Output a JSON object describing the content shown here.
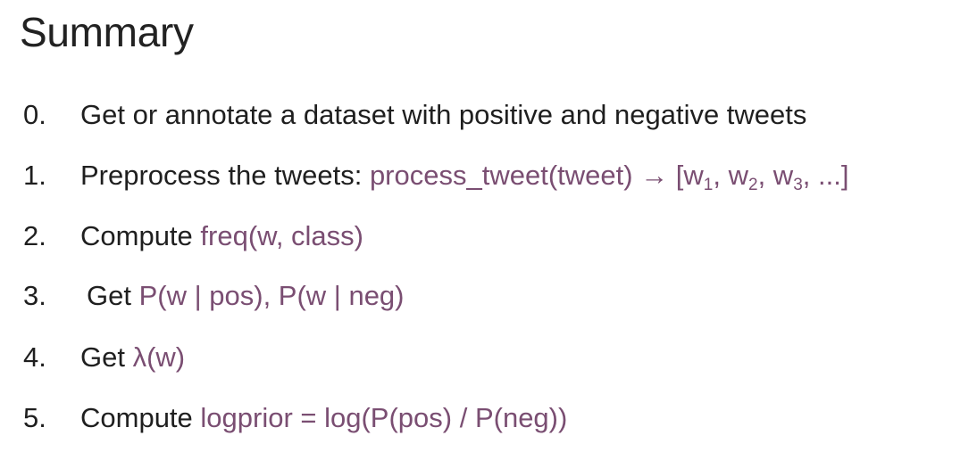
{
  "title": "Summary",
  "steps": [
    {
      "number": "0.",
      "text": "Get or annotate a dataset with positive and negative tweets"
    },
    {
      "number": "1.",
      "text": "Preprocess the tweets: ",
      "code": "process_tweet(tweet) ",
      "arrow": "→",
      "list_open": " [w",
      "w1_sub": "1",
      "sep1": ", w",
      "w2_sub": "2",
      "sep2": ", w",
      "w3_sub": "3",
      "list_close": ", ...]"
    },
    {
      "number": "2.",
      "text": "Compute ",
      "code": "freq(w, class)"
    },
    {
      "number": "3.",
      "text": "Get ",
      "code": "P(w | pos), P(w | neg)"
    },
    {
      "number": "4.",
      "text": "Get ",
      "lambda": "λ",
      "code": "(w)"
    },
    {
      "number": "5.",
      "text": "Compute ",
      "code": "logprior = log(P(pos) / P(neg))"
    }
  ],
  "colors": {
    "text": "#1f1f1f",
    "code": "#7a4e72",
    "background": "#ffffff"
  }
}
